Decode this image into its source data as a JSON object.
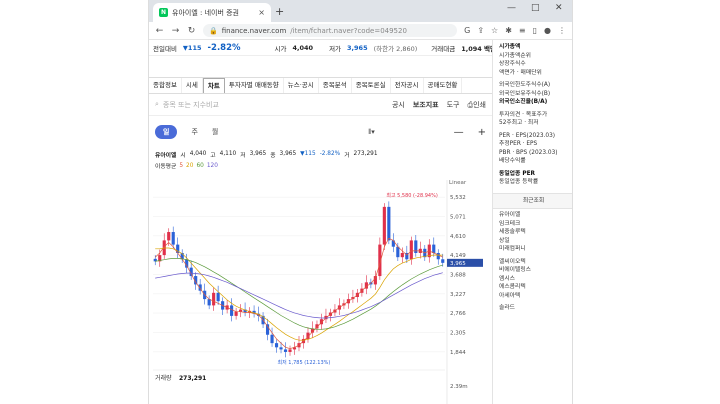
{
  "browser": {
    "tab_title": "유아이엘 : 네이버 증권",
    "url_domain": "finance.naver.com",
    "url_path": "/item/fchart.naver?code=049520",
    "favicon_text": "N",
    "newtab_label": "+",
    "close_label": "×",
    "win_minimize": "—",
    "win_maximize": "□",
    "win_close": "✕"
  },
  "stock_header": {
    "prev_label": "전일대비",
    "change": "▼115",
    "change_pct": "-2.82%",
    "open_label": "시가",
    "open_value": "4,040",
    "low_label": "저가",
    "low_value": "3,965",
    "low_limit": "(하한가 2,860)",
    "amount_label": "거래대금",
    "amount_value": "1,094 백만"
  },
  "nav_tabs": [
    {
      "label": "종합정보"
    },
    {
      "label": "시세"
    },
    {
      "label": "차트"
    },
    {
      "label": "투자자별 매매동향"
    },
    {
      "label": "뉴스·공시"
    },
    {
      "label": "종목분석"
    },
    {
      "label": "종목토론실"
    },
    {
      "label": "전자공시"
    },
    {
      "label": "공매도현황"
    }
  ],
  "toolbar": {
    "search_placeholder": "종목 또는 지수비교",
    "disclosure": "공시",
    "indicator": "보조지표",
    "tools": "도구",
    "print": "인쇄"
  },
  "periods": {
    "day": "일",
    "week": "주",
    "month": "월",
    "zoom_out": "—",
    "zoom_in": "+"
  },
  "ohlc": {
    "name": "유아이엘",
    "open_label": "시",
    "open": "4,040",
    "high_label": "고",
    "high": "4,110",
    "low_label": "저",
    "low": "3,965",
    "close_label": "종",
    "close": "3,965",
    "change": "▼115",
    "change_pct": "-2.82%",
    "volume_label": "거",
    "volume": "273,291"
  },
  "ma": {
    "label": "이동평균",
    "p5": "5",
    "p20": "20",
    "p60": "60",
    "p120": "120"
  },
  "sidebar": {
    "lines": [
      {
        "t": "시가총액",
        "b": true
      },
      {
        "t": "시가총액순위",
        "b": false
      },
      {
        "t": "상장주식수",
        "b": false
      },
      {
        "t": "액면가 · 매매단위",
        "b": false
      },
      {
        "t": "",
        "b": false
      },
      {
        "t": "외국인한도주식수(A)",
        "b": false
      },
      {
        "t": "외국인보유주식수(B)",
        "b": false
      },
      {
        "t": "외국인소진율(B/A)",
        "b": true
      },
      {
        "t": "",
        "b": false
      },
      {
        "t": "투자의견 · 목표주가",
        "b": false
      },
      {
        "t": "52주최고 · 최저",
        "b": false
      },
      {
        "t": "",
        "b": false
      },
      {
        "t": "PER · EPS(2023.03)",
        "b": false
      },
      {
        "t": "추정PER · EPS",
        "b": false
      },
      {
        "t": "PBR · BPS (2023.03)",
        "b": false
      },
      {
        "t": "배당수익률",
        "b": false
      },
      {
        "t": "",
        "b": false
      },
      {
        "t": "동일업종 PER",
        "b": true
      },
      {
        "t": "동일업종 등락률",
        "b": false
      }
    ],
    "recent_title": "최근조회",
    "recent": [
      "유아이엘",
      "임크테크",
      "세중솔루텍",
      "상일",
      "미래컴퍼니",
      "",
      "엘씨이오텍",
      "비에이텔링스",
      "엠시스",
      "에스콤리텍",
      "아세아텍",
      "",
      "솔라드"
    ]
  },
  "chart_data": {
    "type": "candlestick",
    "scale": "Linear",
    "y_ticks": [
      5532,
      5071,
      4610,
      4149,
      3688,
      3227,
      2766,
      2305,
      1844
    ],
    "y_range": [
      1600,
      5750
    ],
    "last_price": "3,965",
    "max_label": "최고 5,580 (-28.94%)",
    "min_label": "최저 1,785 (122.13%)",
    "volume_label": "거래량",
    "volume_value": "273,291",
    "volume_tick": "2.39m",
    "closes": [
      4000,
      4150,
      4500,
      4700,
      4400,
      4200,
      4050,
      3850,
      3650,
      3450,
      3300,
      3100,
      2950,
      3250,
      3050,
      2850,
      2950,
      2700,
      2800,
      2850,
      2780,
      2820,
      2750,
      2700,
      2500,
      2250,
      2050,
      1950,
      1900,
      1840,
      1900,
      1950,
      2050,
      2150,
      2300,
      2400,
      2500,
      2620,
      2700,
      2780,
      2850,
      2950,
      3000,
      3100,
      3150,
      3250,
      3350,
      3500,
      3450,
      3650,
      4400,
      5300,
      4500,
      4350,
      4100,
      4200,
      4050,
      4500,
      4200,
      4300,
      4100,
      4400,
      4200,
      4050,
      3965
    ],
    "ma5": [
      4100,
      4200,
      4350,
      4450,
      4350,
      4200,
      4050,
      3900,
      3700,
      3500,
      3350,
      3200,
      3100,
      3050,
      3000,
      2950,
      2900,
      2850,
      2800,
      2800,
      2780,
      2780,
      2760,
      2720,
      2600,
      2450,
      2300,
      2150,
      2050,
      1950,
      1920,
      1950,
      2000,
      2100,
      2200,
      2320,
      2430,
      2550,
      2650,
      2740,
      2820,
      2900,
      2970,
      3050,
      3120,
      3200,
      3300,
      3400,
      3480,
      3600,
      3950,
      4350,
      4550,
      4500,
      4350,
      4250,
      4150,
      4250,
      4250,
      4250,
      4200,
      4250,
      4200,
      4150,
      4100
    ],
    "ma20": [
      4300,
      4300,
      4320,
      4320,
      4300,
      4250,
      4180,
      4080,
      3960,
      3840,
      3720,
      3600,
      3480,
      3380,
      3280,
      3180,
      3080,
      3000,
      2930,
      2880,
      2840,
      2800,
      2770,
      2740,
      2680,
      2600,
      2510,
      2420,
      2340,
      2260,
      2200,
      2150,
      2120,
      2120,
      2140,
      2180,
      2230,
      2290,
      2360,
      2430,
      2500,
      2570,
      2650,
      2730,
      2800,
      2880,
      2960,
      3040,
      3120,
      3220,
      3380,
      3560,
      3700,
      3820,
      3900,
      3960,
      4000,
      4050,
      4080,
      4100,
      4120,
      4140,
      4150,
      4150,
      4150
    ],
    "ma60": [
      4000,
      4020,
      4040,
      4060,
      4070,
      4070,
      4060,
      4040,
      4010,
      3970,
      3920,
      3870,
      3810,
      3750,
      3690,
      3620,
      3550,
      3480,
      3410,
      3340,
      3270,
      3200,
      3130,
      3060,
      2990,
      2920,
      2850,
      2780,
      2710,
      2650,
      2590,
      2530,
      2480,
      2440,
      2410,
      2390,
      2380,
      2380,
      2390,
      2410,
      2440,
      2480,
      2520,
      2570,
      2620,
      2680,
      2740,
      2800,
      2860,
      2930,
      3010,
      3100,
      3190,
      3280,
      3360,
      3440,
      3510,
      3580,
      3640,
      3700,
      3750,
      3800,
      3840,
      3880,
      3910
    ],
    "ma120": [
      3600,
      3620,
      3640,
      3660,
      3680,
      3700,
      3710,
      3720,
      3720,
      3710,
      3700,
      3680,
      3650,
      3620,
      3580,
      3540,
      3500,
      3450,
      3400,
      3350,
      3300,
      3250,
      3200,
      3150,
      3100,
      3050,
      3000,
      2950,
      2900,
      2850,
      2810,
      2770,
      2740,
      2710,
      2690,
      2670,
      2660,
      2650,
      2650,
      2660,
      2670,
      2690,
      2710,
      2740,
      2770,
      2800,
      2840,
      2880,
      2920,
      2970,
      3020,
      3080,
      3140,
      3200,
      3260,
      3320,
      3380,
      3440,
      3490,
      3540,
      3590,
      3630,
      3670,
      3700,
      3730
    ]
  },
  "colors": {
    "up": "#e0304a",
    "down": "#2b62d8",
    "accent": "#4a6bd8",
    "ma5": "#e0573a",
    "ma20": "#d9a300",
    "ma60": "#5a9a3a",
    "ma120": "#6a5acd"
  }
}
